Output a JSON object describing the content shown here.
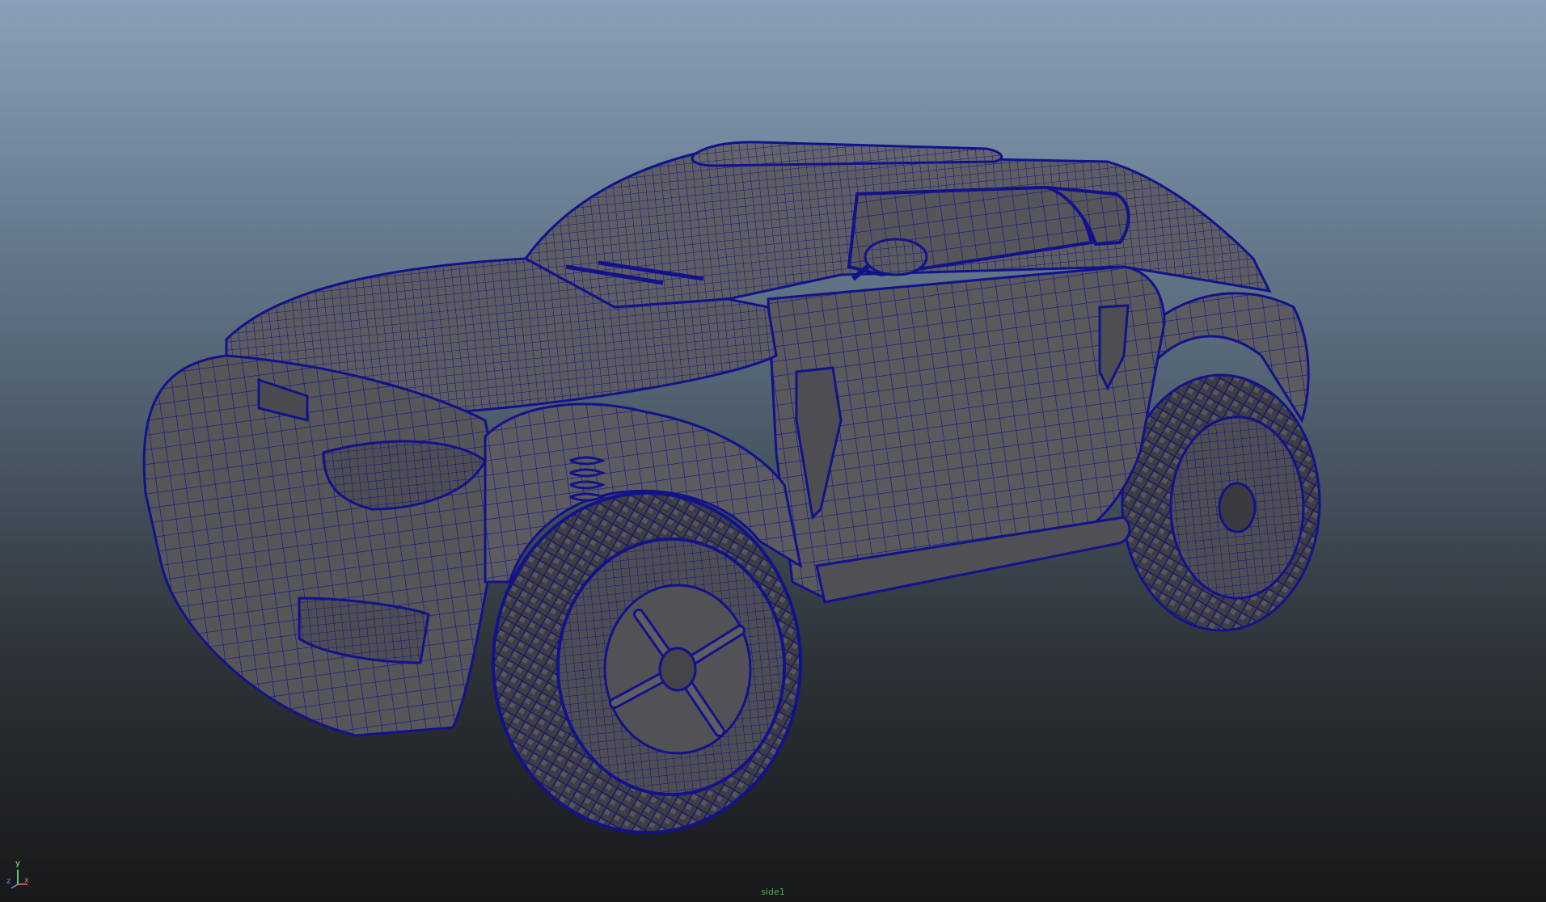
{
  "viewport": {
    "camera_name": "side1",
    "mesh_color": "#12128c",
    "surface_color": "#5a5a5c",
    "gradient_top": "#8aa0b8",
    "gradient_bottom": "#17181a"
  },
  "axis": {
    "y_label": "y",
    "x_label": "x",
    "z_label": "z",
    "icon": "axis-gizmo-icon"
  }
}
